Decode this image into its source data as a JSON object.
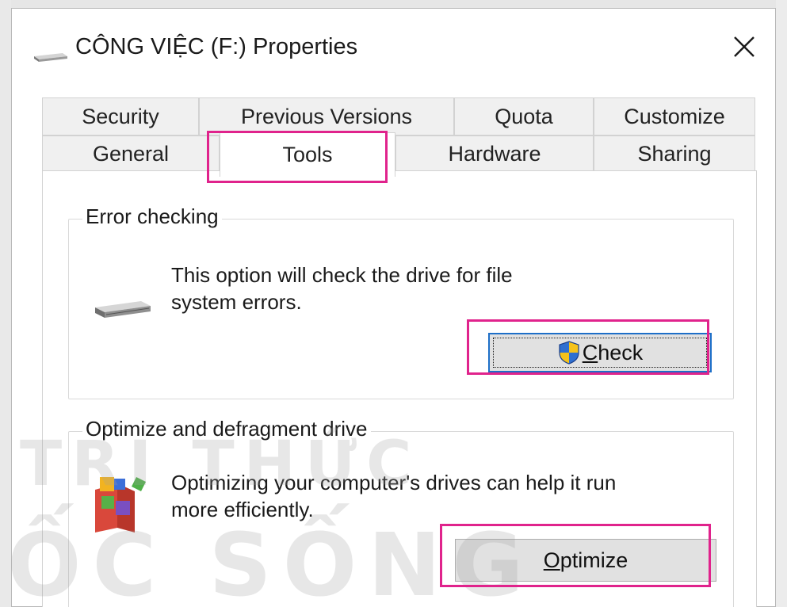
{
  "window": {
    "title": "CÔNG VIỆC (F:) Properties",
    "close_glyph": "✕"
  },
  "tabs": {
    "row1": [
      "Security",
      "Previous Versions",
      "Quota",
      "Customize"
    ],
    "row2": [
      "General",
      "Tools",
      "Hardware",
      "Sharing"
    ],
    "active": "Tools"
  },
  "error_checking": {
    "title": "Error checking",
    "desc_line1": "This option will check the drive for file",
    "desc_line2": "system errors.",
    "button_label_first": "C",
    "button_label_rest": "heck",
    "button_icon": "uac-shield-icon"
  },
  "optimize": {
    "title": "Optimize and defragment drive",
    "desc_line1": "Optimizing your computer's drives can help it run",
    "desc_line2": "more efficiently.",
    "button_label_first": "O",
    "button_label_rest": "ptimize",
    "button_icon": "defrag-icon"
  },
  "watermark": {
    "line1": "TRI THỨC",
    "line2": "ỐC SỐNG"
  },
  "colors": {
    "highlight": "#e0238c",
    "focus": "#1e6fc8",
    "button_face": "#e1e1e1"
  }
}
